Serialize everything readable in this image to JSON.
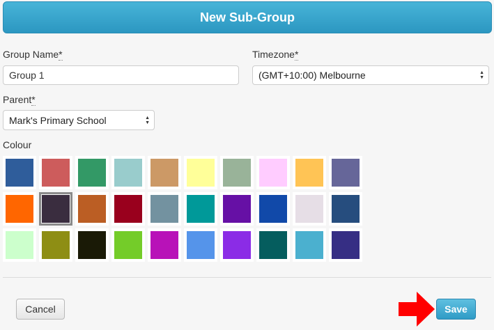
{
  "dialog": {
    "title": "New Sub-Group"
  },
  "form": {
    "group_name": {
      "label": "Group Name",
      "required_mark": "*",
      "value": "Group 1"
    },
    "timezone": {
      "label": "Timezone",
      "required_mark": "*",
      "value": "(GMT+10:00) Melbourne"
    },
    "parent": {
      "label": "Parent",
      "required_mark": "*",
      "value": "Mark's Primary School"
    },
    "colour": {
      "label": "Colour",
      "selected_index": 11,
      "swatches": [
        "#2f5d9b",
        "#cd5c5c",
        "#339966",
        "#99cccc",
        "#cc9966",
        "#ffff99",
        "#99b399",
        "#ffccff",
        "#ffc455",
        "#666699",
        "#ff6600",
        "#3a2d3f",
        "#bb5e24",
        "#99001d",
        "#7392a0",
        "#009999",
        "#6610a5",
        "#1149a9",
        "#e6dee6",
        "#264d7e",
        "#ccffcc",
        "#8e8e14",
        "#1a1a06",
        "#74cc29",
        "#b812b8",
        "#5594ea",
        "#8b2ce6",
        "#055d5e",
        "#4bb0cf",
        "#362e84"
      ]
    }
  },
  "footer": {
    "cancel_label": "Cancel",
    "save_label": "Save",
    "arrow_color": "#ff0000"
  }
}
